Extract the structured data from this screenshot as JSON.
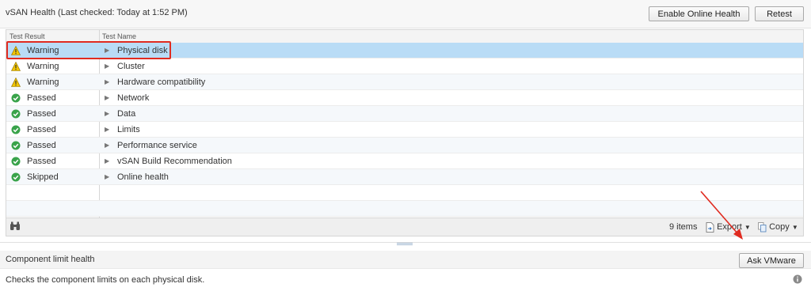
{
  "header": {
    "title": "vSAN Health (Last checked: Today at 1:52 PM)",
    "enable_online_health_label": "Enable Online Health",
    "retest_label": "Retest"
  },
  "grid": {
    "columns": {
      "result": "Test Result",
      "name": "Test Name"
    },
    "rows": [
      {
        "status": "warning",
        "result": "Warning",
        "name": "Physical disk"
      },
      {
        "status": "warning",
        "result": "Warning",
        "name": "Cluster"
      },
      {
        "status": "warning",
        "result": "Warning",
        "name": "Hardware compatibility"
      },
      {
        "status": "passed",
        "result": "Passed",
        "name": "Network"
      },
      {
        "status": "passed",
        "result": "Passed",
        "name": "Data"
      },
      {
        "status": "passed",
        "result": "Passed",
        "name": "Limits"
      },
      {
        "status": "passed",
        "result": "Passed",
        "name": "Performance service"
      },
      {
        "status": "passed",
        "result": "Passed",
        "name": "vSAN Build Recommendation"
      },
      {
        "status": "skipped",
        "result": "Skipped",
        "name": "Online health"
      }
    ],
    "footer": {
      "items_count": "9 items",
      "export_label": "Export",
      "copy_label": "Copy"
    }
  },
  "detail": {
    "title": "Component limit health",
    "ask_vmware_label": "Ask VMware",
    "description": "Checks the component limits on each physical disk."
  },
  "colors": {
    "selected_row": "#b9dcf6",
    "highlight": "#e02b20",
    "warning": "#f2c500",
    "passed": "#39a34a"
  }
}
